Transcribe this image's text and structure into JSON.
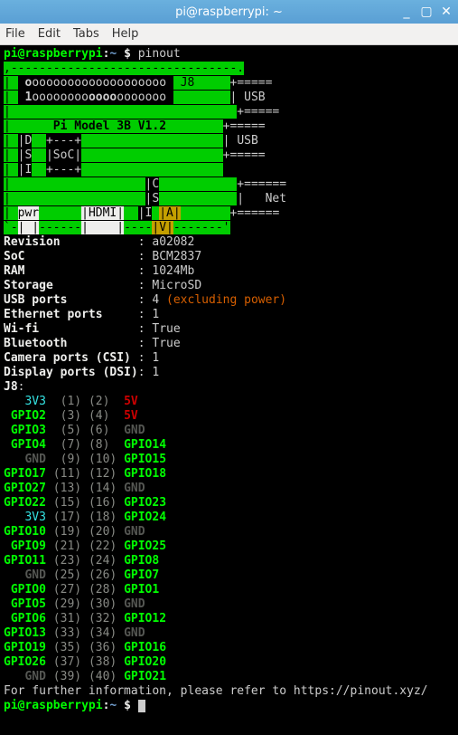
{
  "window": {
    "title": "pi@raspberrypi: ~",
    "controls": {
      "minimize": "_",
      "maximize": "▢",
      "close": "✕"
    }
  },
  "menu": {
    "file": "File",
    "edit": "Edit",
    "tabs": "Tabs",
    "help": "Help"
  },
  "prompt": {
    "userhost": "pi@raspberrypi",
    "path": "~",
    "sep": ":",
    "dollar": "$"
  },
  "command": "pinout",
  "board": {
    "model": "Pi Model 3B V1.2",
    "j8_label": "J8",
    "usb": "USB",
    "net": "Net",
    "dsi": "DSI",
    "soc": "SoC",
    "csi": "CSI",
    "av": "A|V",
    "hdmi": "HDMI",
    "pwr": "pwr"
  },
  "specs_labels": {
    "revision": "Revision",
    "soc": "SoC",
    "ram": "RAM",
    "storage": "Storage",
    "usb_ports": "USB ports",
    "eth_ports": "Ethernet ports",
    "wifi": "Wi-fi",
    "bt": "Bluetooth",
    "csi": "Camera ports (CSI)",
    "dsi": "Display ports (DSI)"
  },
  "specs": {
    "revision": "a02082",
    "soc": "BCM2837",
    "ram": "1024Mb",
    "storage": "MicroSD",
    "usb_ports": "4",
    "usb_note": "(excluding power)",
    "eth_ports": "1",
    "wifi": "True",
    "bt": "True",
    "csi": "1",
    "dsi": "1"
  },
  "pinout_header": "J8",
  "pins": [
    {
      "a": "3V3",
      "ac": "c-cyan",
      "n1": "(1)",
      "n2": "(2)",
      "b": "5V",
      "bc": "c-red"
    },
    {
      "a": "GPIO2",
      "ac": "c-bgreen",
      "n1": "(3)",
      "n2": "(4)",
      "b": "5V",
      "bc": "c-red"
    },
    {
      "a": "GPIO3",
      "ac": "c-bgreen",
      "n1": "(5)",
      "n2": "(6)",
      "b": "GND",
      "bc": "c-dgrey"
    },
    {
      "a": "GPIO4",
      "ac": "c-bgreen",
      "n1": "(7)",
      "n2": "(8)",
      "b": "GPIO14",
      "bc": "c-bgreen"
    },
    {
      "a": "GND",
      "ac": "c-dgrey",
      "n1": "(9)",
      "n2": "(10)",
      "b": "GPIO15",
      "bc": "c-bgreen"
    },
    {
      "a": "GPIO17",
      "ac": "c-bgreen",
      "n1": "(11)",
      "n2": "(12)",
      "b": "GPIO18",
      "bc": "c-bgreen"
    },
    {
      "a": "GPIO27",
      "ac": "c-bgreen",
      "n1": "(13)",
      "n2": "(14)",
      "b": "GND",
      "bc": "c-dgrey"
    },
    {
      "a": "GPIO22",
      "ac": "c-bgreen",
      "n1": "(15)",
      "n2": "(16)",
      "b": "GPIO23",
      "bc": "c-bgreen"
    },
    {
      "a": "3V3",
      "ac": "c-cyan",
      "n1": "(17)",
      "n2": "(18)",
      "b": "GPIO24",
      "bc": "c-bgreen"
    },
    {
      "a": "GPIO10",
      "ac": "c-bgreen",
      "n1": "(19)",
      "n2": "(20)",
      "b": "GND",
      "bc": "c-dgrey"
    },
    {
      "a": "GPIO9",
      "ac": "c-bgreen",
      "n1": "(21)",
      "n2": "(22)",
      "b": "GPIO25",
      "bc": "c-bgreen"
    },
    {
      "a": "GPIO11",
      "ac": "c-bgreen",
      "n1": "(23)",
      "n2": "(24)",
      "b": "GPIO8",
      "bc": "c-bgreen"
    },
    {
      "a": "GND",
      "ac": "c-dgrey",
      "n1": "(25)",
      "n2": "(26)",
      "b": "GPIO7",
      "bc": "c-bgreen"
    },
    {
      "a": "GPIO0",
      "ac": "c-bgreen",
      "n1": "(27)",
      "n2": "(28)",
      "b": "GPIO1",
      "bc": "c-bgreen"
    },
    {
      "a": "GPIO5",
      "ac": "c-bgreen",
      "n1": "(29)",
      "n2": "(30)",
      "b": "GND",
      "bc": "c-dgrey"
    },
    {
      "a": "GPIO6",
      "ac": "c-bgreen",
      "n1": "(31)",
      "n2": "(32)",
      "b": "GPIO12",
      "bc": "c-bgreen"
    },
    {
      "a": "GPIO13",
      "ac": "c-bgreen",
      "n1": "(33)",
      "n2": "(34)",
      "b": "GND",
      "bc": "c-dgrey"
    },
    {
      "a": "GPIO19",
      "ac": "c-bgreen",
      "n1": "(35)",
      "n2": "(36)",
      "b": "GPIO16",
      "bc": "c-bgreen"
    },
    {
      "a": "GPIO26",
      "ac": "c-bgreen",
      "n1": "(37)",
      "n2": "(38)",
      "b": "GPIO20",
      "bc": "c-bgreen"
    },
    {
      "a": "GND",
      "ac": "c-dgrey",
      "n1": "(39)",
      "n2": "(40)",
      "b": "GPIO21",
      "bc": "c-bgreen"
    }
  ],
  "footer": "For further information, please refer to https://pinout.xyz/"
}
